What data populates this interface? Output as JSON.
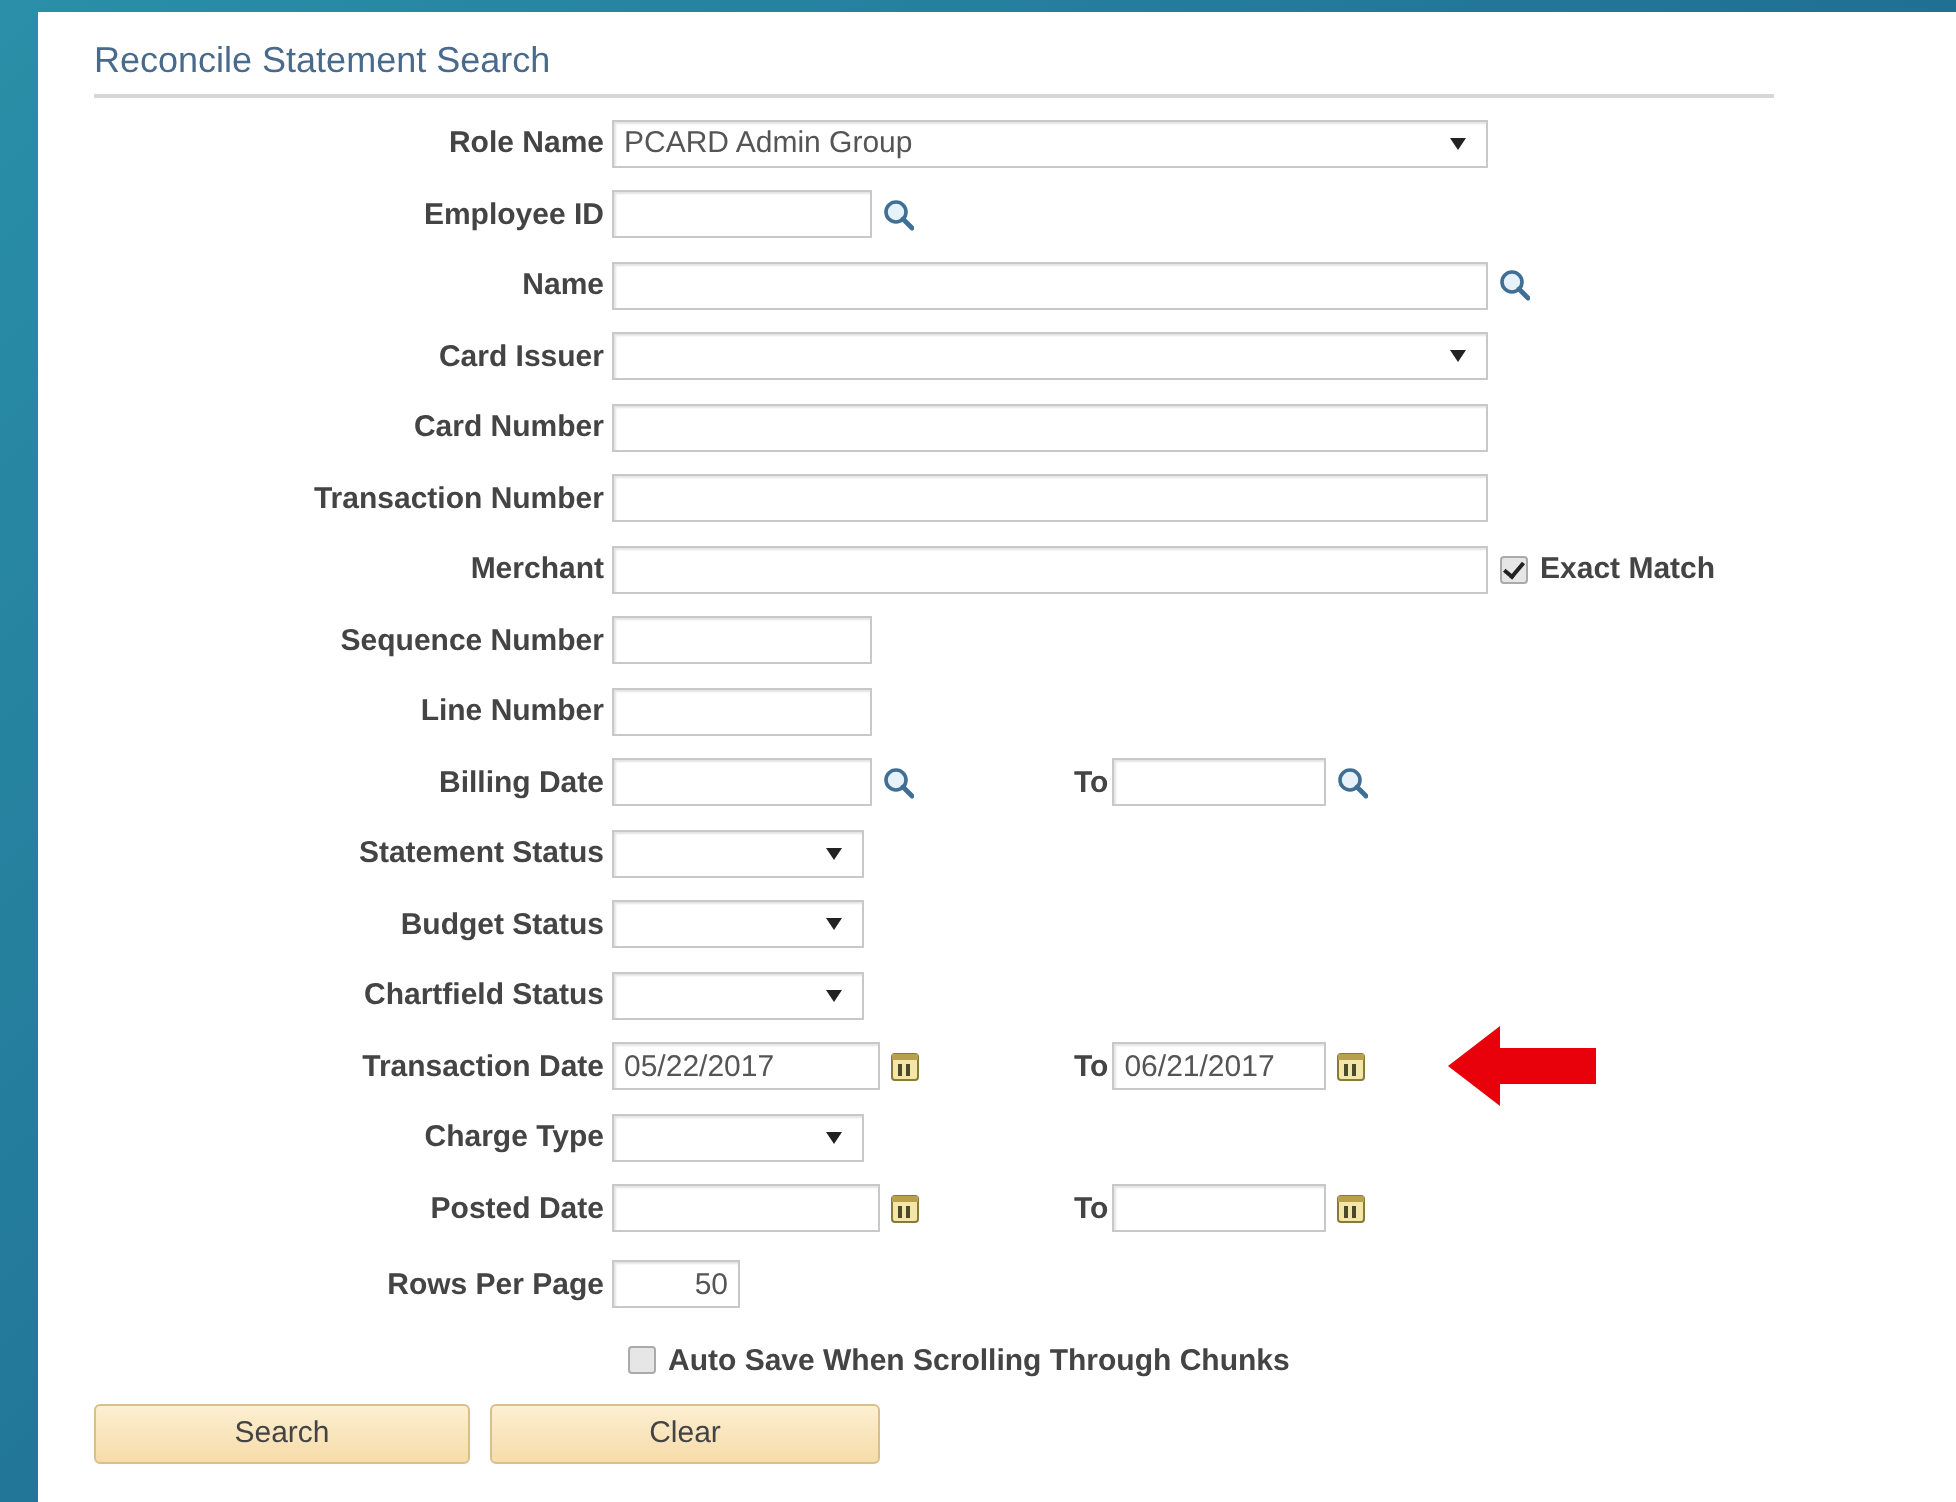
{
  "page": {
    "title": "Reconcile Statement Search"
  },
  "rows": [
    {
      "label": "Role Name",
      "field": {
        "kind": "wide_select",
        "value": "PCARD Admin Group"
      },
      "highlighted": false
    },
    {
      "label": "Employee ID",
      "field": {
        "kind": "short_lookup"
      },
      "highlighted": false
    },
    {
      "label": "Name",
      "field": {
        "kind": "wide_lookup"
      },
      "highlighted": false
    },
    {
      "label": "Card Issuer",
      "field": {
        "kind": "wide_select"
      },
      "highlighted": false
    },
    {
      "label": "Card Number",
      "field": {
        "kind": "wide_text"
      },
      "highlighted": false
    },
    {
      "label": "Transaction Number",
      "field": {
        "kind": "wide_text"
      },
      "highlighted": false
    },
    {
      "label": "Merchant",
      "field": {
        "kind": "wide_text"
      },
      "option": {
        "label": "Exact Match",
        "checked": true
      },
      "highlighted": false
    },
    {
      "label": "Sequence Number",
      "field": {
        "kind": "short_text"
      },
      "highlighted": false
    },
    {
      "label": "Line Number",
      "field": {
        "kind": "short_text"
      },
      "highlighted": false
    },
    {
      "label": "Billing Date",
      "field": {
        "kind": "short_lookup"
      },
      "range_to": {
        "label": "To",
        "field": {
          "kind": "short_lookup"
        }
      },
      "highlighted": false
    },
    {
      "label": "Statement Status",
      "field": {
        "kind": "short_select"
      },
      "highlighted": false
    },
    {
      "label": "Budget Status",
      "field": {
        "kind": "short_select"
      },
      "highlighted": false
    },
    {
      "label": "Chartfield Status",
      "field": {
        "kind": "short_select"
      },
      "highlighted": false
    },
    {
      "label": "Transaction Date",
      "field": {
        "kind": "date",
        "value": "05/22/2017"
      },
      "range_to": {
        "label": "To",
        "field": {
          "kind": "date",
          "value": "06/21/2017"
        }
      },
      "highlighted": true
    },
    {
      "label": "Charge Type",
      "field": {
        "kind": "short_select"
      },
      "highlighted": false
    },
    {
      "label": "Posted Date",
      "field": {
        "kind": "date"
      },
      "range_to": {
        "label": "To",
        "field": {
          "kind": "date"
        }
      },
      "highlighted": false
    },
    {
      "label": "Rows Per Page",
      "field": {
        "kind": "number",
        "value": "50"
      },
      "highlighted": false
    }
  ],
  "auto_save": {
    "label": "Auto Save When Scrolling Through Chunks",
    "checked": false
  },
  "buttons": [
    {
      "label": "Search"
    },
    {
      "label": "Clear"
    }
  ]
}
